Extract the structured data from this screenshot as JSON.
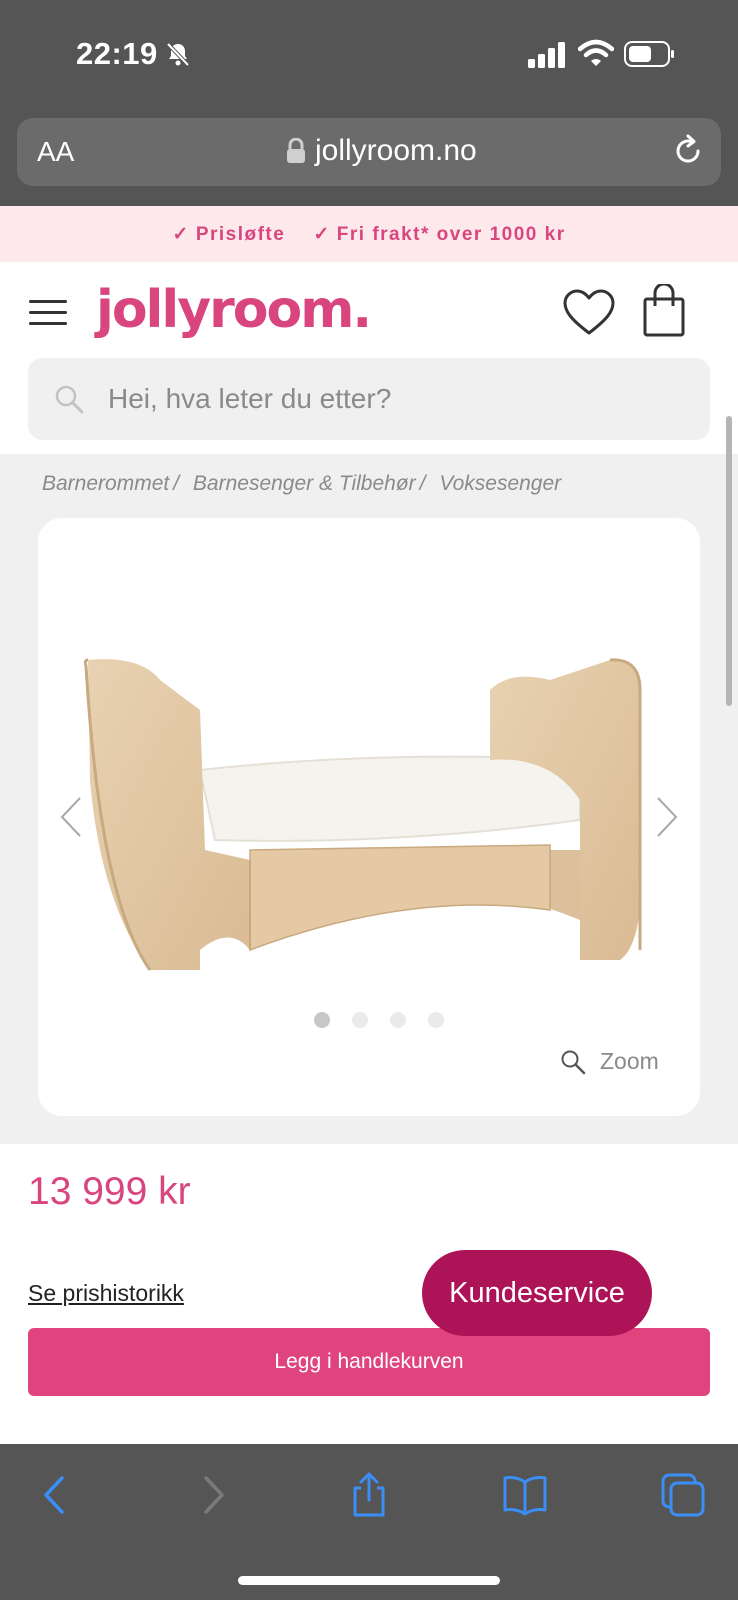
{
  "status_bar": {
    "time": "22:19"
  },
  "browser": {
    "text_size_label": "AA",
    "url": "jollyroom.no"
  },
  "promo": {
    "items": [
      "Prisløfte",
      "Fri frakt* over 1000 kr"
    ],
    "check": "✓"
  },
  "header": {
    "logo": "jollyroom.",
    "search_placeholder": "Hei, hva leter du etter?"
  },
  "breadcrumb": [
    "Barnerommet",
    "Barnesenger & Tilbehør",
    "Voksesenger"
  ],
  "breadcrumb_separator": "/",
  "gallery": {
    "image_count": 4,
    "active_index": 0,
    "zoom_label": "Zoom"
  },
  "product": {
    "price": "13 999 kr",
    "price_history_label": "Se prishistorikk",
    "customer_service_label": "Kundeservice",
    "add_to_cart_label": "Legg i handlekurven"
  },
  "colors": {
    "brand": "#d9457f",
    "cta": "#e0447f",
    "service": "#ad1457",
    "promo_bg": "#fde9ec",
    "toolbar_blue": "#3a8ef5"
  }
}
